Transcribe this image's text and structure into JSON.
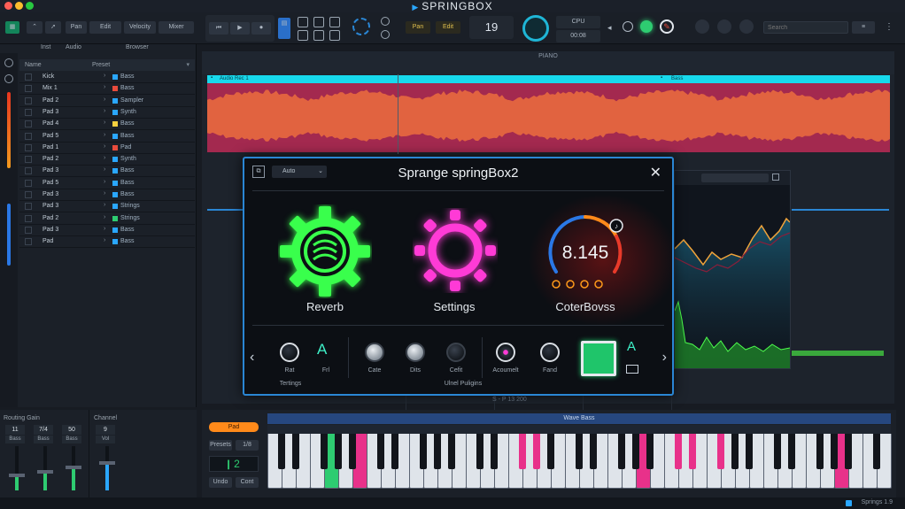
{
  "app": {
    "title": "SPRINGBOX"
  },
  "toolbar": {
    "transport": [
      "⏮",
      "▶",
      "⏺"
    ],
    "mode_buttons": [
      "Pan",
      "Edit",
      "Velocity",
      "Mixer"
    ],
    "tempo_labels": [
      "Pan",
      "Edit"
    ],
    "bar_counter": "19",
    "cpu_label": "CPU",
    "cpu_value": "00:08",
    "search_placeholder": "Search"
  },
  "trackpanel": {
    "tabs": [
      "Inst",
      "Audio",
      "Browser"
    ],
    "header": {
      "col1": "Name",
      "col2": "Preset"
    },
    "tracks": [
      {
        "name": "Kick",
        "label": "Bass",
        "color": "#2aa7ff"
      },
      {
        "name": "Mix 1",
        "label": "Bass",
        "color": "#e84b3c"
      },
      {
        "name": "Pad 2",
        "label": "Sampler",
        "color": "#2aa7ff"
      },
      {
        "name": "Pad 3",
        "label": "Synth",
        "color": "#2aa7ff"
      },
      {
        "name": "Pad 4",
        "label": "Bass",
        "color": "#f4d03f"
      },
      {
        "name": "Pad 5",
        "label": "Bass",
        "color": "#2aa7ff"
      },
      {
        "name": "Pad 1",
        "label": "Pad",
        "color": "#e84b3c"
      },
      {
        "name": "Pad 2",
        "label": "Synth",
        "color": "#2aa7ff"
      },
      {
        "name": "Pad 3",
        "label": "Bass",
        "color": "#2aa7ff"
      },
      {
        "name": "Pad 5",
        "label": "Bass",
        "color": "#2aa7ff"
      },
      {
        "name": "Pad 3",
        "label": "Bass",
        "color": "#2aa7ff"
      },
      {
        "name": "Pad 3",
        "label": "Strings",
        "color": "#2aa7ff"
      },
      {
        "name": "Pad 2",
        "label": "Strings",
        "color": "#2ecc71"
      },
      {
        "name": "Pad 3",
        "label": "Bass",
        "color": "#2aa7ff"
      },
      {
        "name": "Pad",
        "label": "Bass",
        "color": "#2aa7ff"
      }
    ]
  },
  "arrange": {
    "ruler_label": "PIANO",
    "clip_name": "Audio Rec 1",
    "clip_end_label": "Bass"
  },
  "plugin": {
    "title": "Sprange springBox2",
    "preset": "Auto",
    "modules": [
      {
        "label": "Reverb",
        "color": "#39ff4c"
      },
      {
        "label": "Settings",
        "color": "#ff3bd6"
      },
      {
        "label": "CoterBovss",
        "color": "#ff7a1a"
      }
    ],
    "meter_value": "8.145",
    "controls": [
      {
        "label": "Rat"
      },
      {
        "label": "Frl"
      },
      {
        "label": "Cate"
      },
      {
        "label": "Dits"
      },
      {
        "label": "Cefit"
      },
      {
        "label": "Acoumelt"
      },
      {
        "label": "Fand"
      }
    ],
    "group_left": "Tertings",
    "group_mid": "Ulnel Puligins",
    "status_text": "S - P 13 200"
  },
  "mixer": {
    "title": "Routing Gain",
    "title2": "Channel",
    "strips": [
      {
        "value": "11",
        "label": "Bass",
        "level": 0.32,
        "color": "#2ecc71"
      },
      {
        "value": "7/4",
        "label": "Bass",
        "level": 0.4,
        "color": "#2ecc71"
      },
      {
        "value": "50",
        "label": "Bass",
        "level": 0.5,
        "color": "#2ecc71"
      },
      {
        "value": "9",
        "label": "Vol",
        "level": 0.6,
        "color": "#2aa7ff"
      }
    ]
  },
  "piano": {
    "header": "Wave Bass",
    "side_button": "Pad",
    "side_labels": [
      "Presets",
      "1/8"
    ],
    "step_value": "2",
    "step_buttons": [
      "Undo",
      "Cont"
    ],
    "highlight_white_indexes": [
      4,
      6,
      26,
      40
    ],
    "highlight_colors": [
      "#2ecc71",
      "#e8318a",
      "#e8318a",
      "#e8318a"
    ]
  },
  "statusbar": {
    "text": "Springs 1.9"
  }
}
